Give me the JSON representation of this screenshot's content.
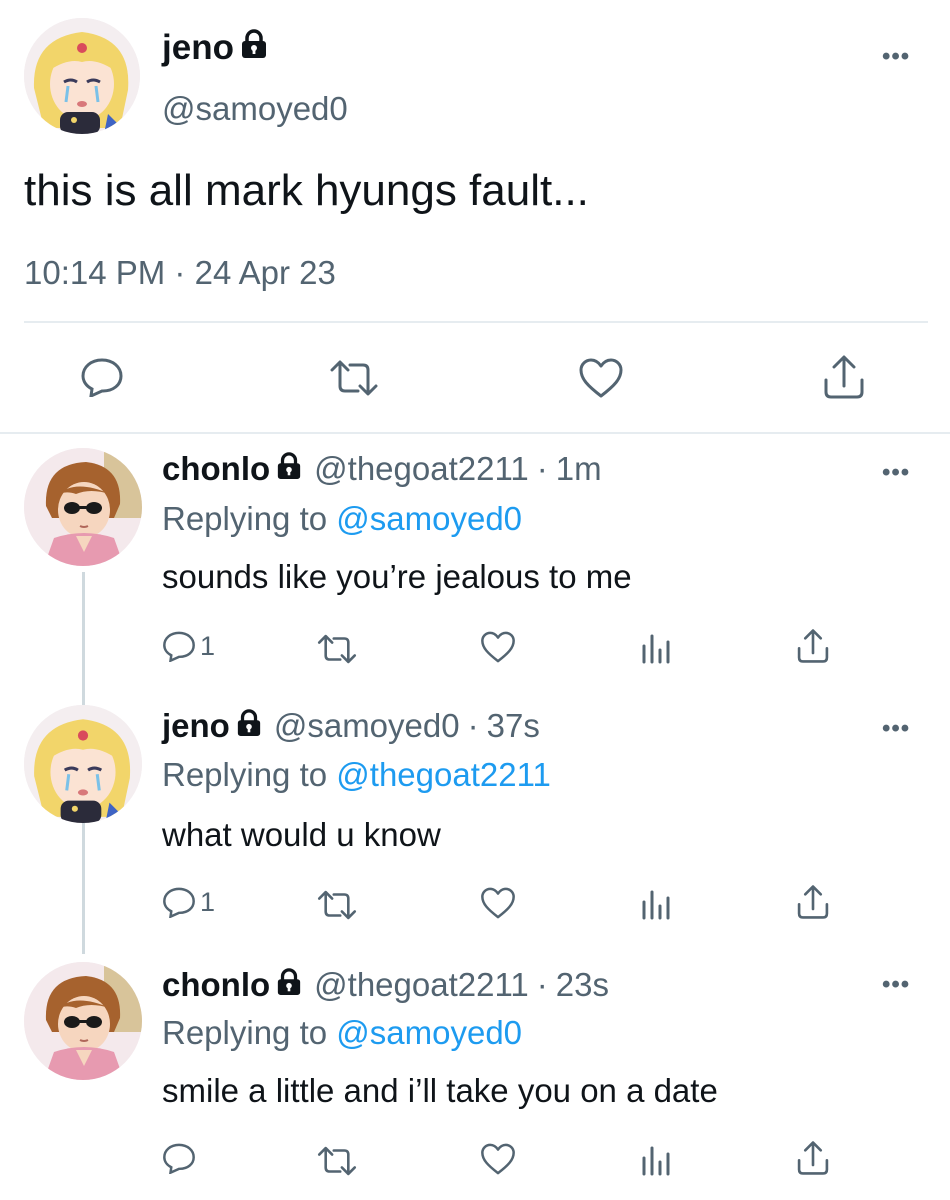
{
  "main_tweet": {
    "display_name": "jeno",
    "handle": "@samoyed0",
    "text": "this is all mark hyungs fault...",
    "time": "10:14 PM",
    "separator": "·",
    "date": "24 Apr 23"
  },
  "replies": [
    {
      "display_name": "chonlo",
      "handle": "@thegoat2211",
      "age": "1m",
      "replying_label": "Replying to",
      "replying_to": "@samoyed0",
      "text": "sounds like you’re jealous to me",
      "reply_count": "1"
    },
    {
      "display_name": "jeno",
      "handle": "@samoyed0",
      "age": "37s",
      "replying_label": "Replying to",
      "replying_to": "@thegoat2211",
      "text": "what would u know",
      "reply_count": "1"
    },
    {
      "display_name": "chonlo",
      "handle": "@thegoat2211",
      "age": "23s",
      "replying_label": "Replying to",
      "replying_to": "@samoyed0",
      "text": "smile a little and i’ll take you on a date",
      "reply_count": ""
    }
  ],
  "meta_separator": "·",
  "more_label": "•••",
  "colors": {
    "link": "#1d9bf0",
    "secondary_text": "#536471",
    "divider": "#e6ecf0",
    "thread_line": "#cfd9de"
  }
}
